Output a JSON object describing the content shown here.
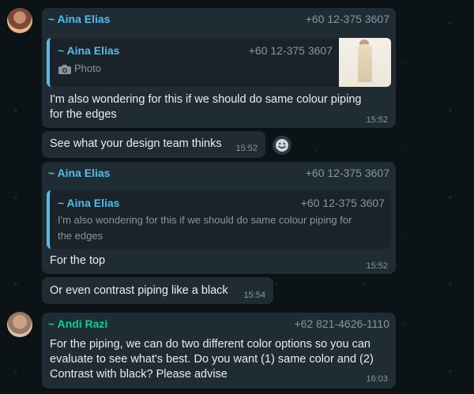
{
  "messages": {
    "m1": {
      "sender": "~ Aina Elias",
      "phone": "+60 12-375 3607",
      "quote": {
        "sender": "~ Aina Elias",
        "phone": "+60 12-375 3607",
        "text": "Photo",
        "icon": "camera-icon"
      },
      "text_line1": "I'm also wondering for this if we should do same colour piping",
      "text_line2": "for the edges",
      "time": "15:52"
    },
    "m2": {
      "text": "See what your design team thinks",
      "time": "15:52"
    },
    "m3": {
      "sender": "~ Aina Elias",
      "phone": "+60 12-375 3607",
      "quote": {
        "sender": "~ Aina Elias",
        "phone": "+60 12-375 3607",
        "text_line1": "I'm also wondering for this if we should do same colour piping for",
        "text_line2": "the edges"
      },
      "text": "For the top",
      "time": "15:52"
    },
    "m4": {
      "text": "Or even contrast piping like a black",
      "time": "15:54"
    },
    "m5": {
      "sender": "~ Andi Razi",
      "phone": "+62 821-4626-1110",
      "text_line1": "For the piping, we can do two different color options so you can",
      "text_line2": "evaluate to see what's best. Do you want (1) same color and (2)",
      "text_line3": "Contrast with black? Please advise",
      "time": "16:03"
    }
  },
  "colors": {
    "aina_name": "#53bdeb",
    "andi_name": "#06cf9c",
    "bubble_bg": "#202c33",
    "chat_bg": "#0c1317"
  }
}
